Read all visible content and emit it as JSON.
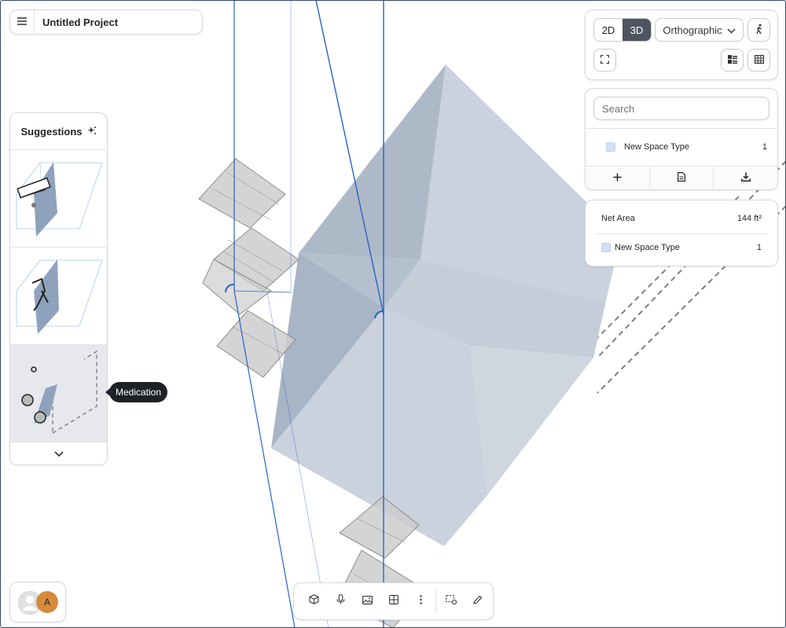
{
  "project": {
    "title": "Untitled Project"
  },
  "suggestions": {
    "title": "Suggestions",
    "tooltip": "Medication"
  },
  "view": {
    "mode_2d": "2D",
    "mode_3d": "3D",
    "active_mode": "3D",
    "projection": "Orthographic"
  },
  "spaces": {
    "search_placeholder": "Search",
    "items": [
      {
        "label": "New Space Type",
        "count": "1",
        "color": "#cfe0f5"
      }
    ]
  },
  "metrics": {
    "net_area_label": "Net Area",
    "net_area_value": "144 ft²",
    "rows": [
      {
        "label": "New Space Type",
        "count": "1",
        "color": "#cfe0f5"
      }
    ]
  },
  "user": {
    "initial": "A",
    "accent": "#d78a3b"
  },
  "colors": {
    "box_fill": "#c3cdd9",
    "guide_line": "#2a62c9",
    "active_segment": "#4e5560"
  }
}
